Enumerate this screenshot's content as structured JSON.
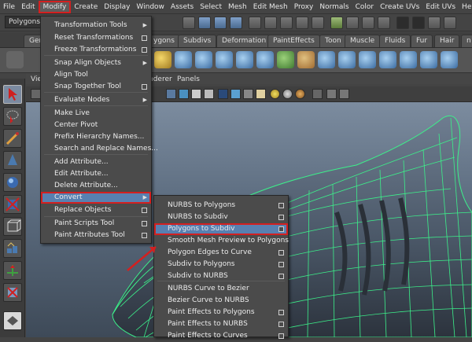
{
  "menubar": {
    "items": [
      "File",
      "Edit",
      "Modify",
      "Create",
      "Display",
      "Window",
      "Assets",
      "Select",
      "Mesh",
      "Edit Mesh",
      "Proxy",
      "Normals",
      "Color",
      "Create UVs",
      "Edit UVs",
      "Help"
    ],
    "active_index": 2
  },
  "toolbar": {
    "mode_value": "Polygons"
  },
  "shelf": {
    "tabs": [
      "Ger",
      "ygons",
      "Subdivs",
      "Deformation",
      "PaintEffects",
      "Toon",
      "Muscle",
      "Fluids",
      "Fur",
      "Hair",
      "n"
    ]
  },
  "panel_menu": {
    "renderer": "nderer",
    "panels": "Panels"
  },
  "viewport_label": "Vie",
  "modify_menu": {
    "items": [
      {
        "label": "Transformation Tools",
        "marker": "sub"
      },
      {
        "label": "Reset Transformations",
        "marker": "opt"
      },
      {
        "label": "Freeze Transformations",
        "marker": "opt"
      },
      {
        "label": "Snap Align Objects",
        "marker": "sub"
      },
      {
        "label": "Align Tool",
        "marker": "none"
      },
      {
        "label": "Snap Together Tool",
        "marker": "opt"
      },
      {
        "label": "Evaluate Nodes",
        "marker": "sub"
      },
      {
        "label": "Make Live",
        "marker": "none"
      },
      {
        "label": "Center Pivot",
        "marker": "none"
      },
      {
        "label": "Prefix Hierarchy Names...",
        "marker": "none"
      },
      {
        "label": "Search and Replace Names...",
        "marker": "none"
      },
      {
        "label": "Add Attribute...",
        "marker": "none"
      },
      {
        "label": "Edit Attribute...",
        "marker": "none"
      },
      {
        "label": "Delete Attribute...",
        "marker": "none"
      },
      {
        "label": "Convert",
        "marker": "sub"
      },
      {
        "label": "Replace Objects",
        "marker": "opt"
      },
      {
        "label": "Paint Scripts Tool",
        "marker": "opt"
      },
      {
        "label": "Paint Attributes Tool",
        "marker": "opt"
      }
    ]
  },
  "convert_menu": {
    "items": [
      {
        "label": "NURBS to Polygons",
        "marker": "opt"
      },
      {
        "label": "NURBS to Subdiv",
        "marker": "opt"
      },
      {
        "label": "Polygons to Subdiv",
        "marker": "opt"
      },
      {
        "label": "Smooth Mesh Preview to Polygons",
        "marker": "none"
      },
      {
        "label": "Polygon Edges to Curve",
        "marker": "opt"
      },
      {
        "label": "Subdiv to Polygons",
        "marker": "opt"
      },
      {
        "label": "Subdiv to NURBS",
        "marker": "opt"
      },
      {
        "label": "NURBS Curve to Bezier",
        "marker": "none"
      },
      {
        "label": "Bezier Curve to NURBS",
        "marker": "none"
      },
      {
        "label": "Paint Effects to Polygons",
        "marker": "opt"
      },
      {
        "label": "Paint Effects to NURBS",
        "marker": "opt"
      },
      {
        "label": "Paint Effects to Curves",
        "marker": "opt"
      }
    ]
  },
  "colors": {
    "highlight": "#5880b0",
    "callout_red": "#d32020",
    "wireframe": "#3cf08a"
  }
}
